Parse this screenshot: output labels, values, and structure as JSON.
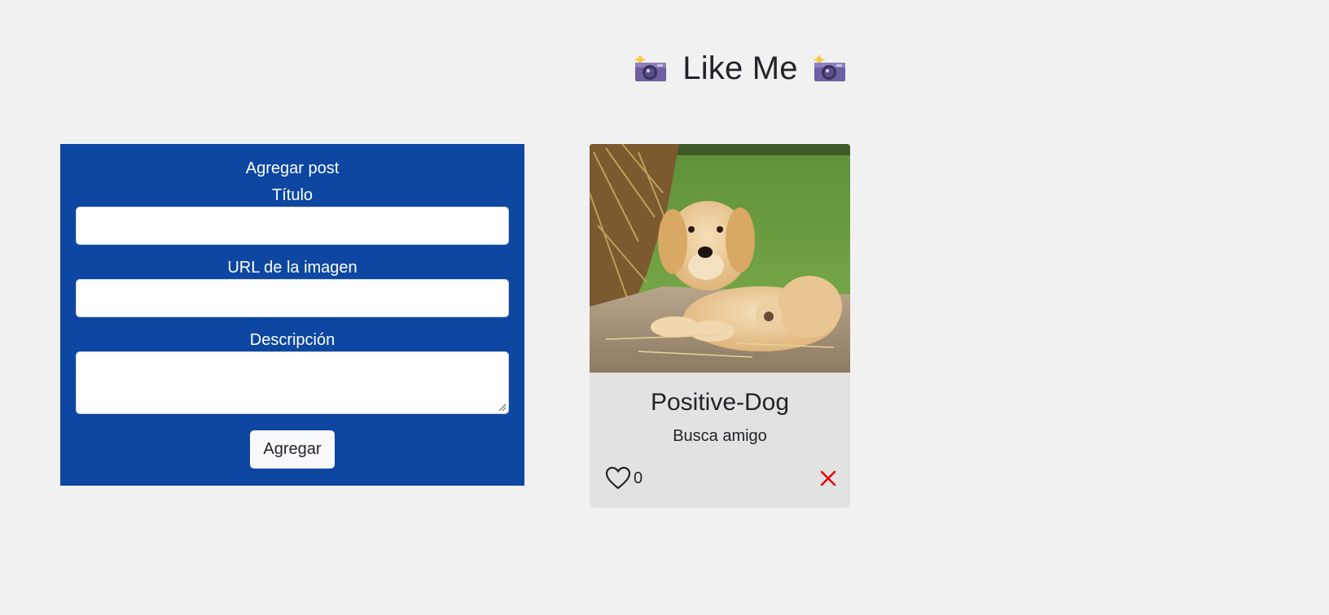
{
  "header": {
    "title": "Like Me",
    "left_icon": "camera-flash-icon",
    "right_icon": "camera-flash-icon"
  },
  "form": {
    "heading": "Agregar post",
    "title_label": "Título",
    "title_value": "",
    "url_label": "URL de la imagen",
    "url_value": "",
    "description_label": "Descripción",
    "description_value": "",
    "submit_label": "Agregar",
    "background_color": "#0d47a1"
  },
  "posts": [
    {
      "title": "Positive-Dog",
      "description": "Busca amigo",
      "likes": "0",
      "image_icon": "puppy-photo",
      "like_icon": "heart-outline-icon",
      "delete_icon": "x-icon",
      "delete_color": "#e00000"
    }
  ]
}
